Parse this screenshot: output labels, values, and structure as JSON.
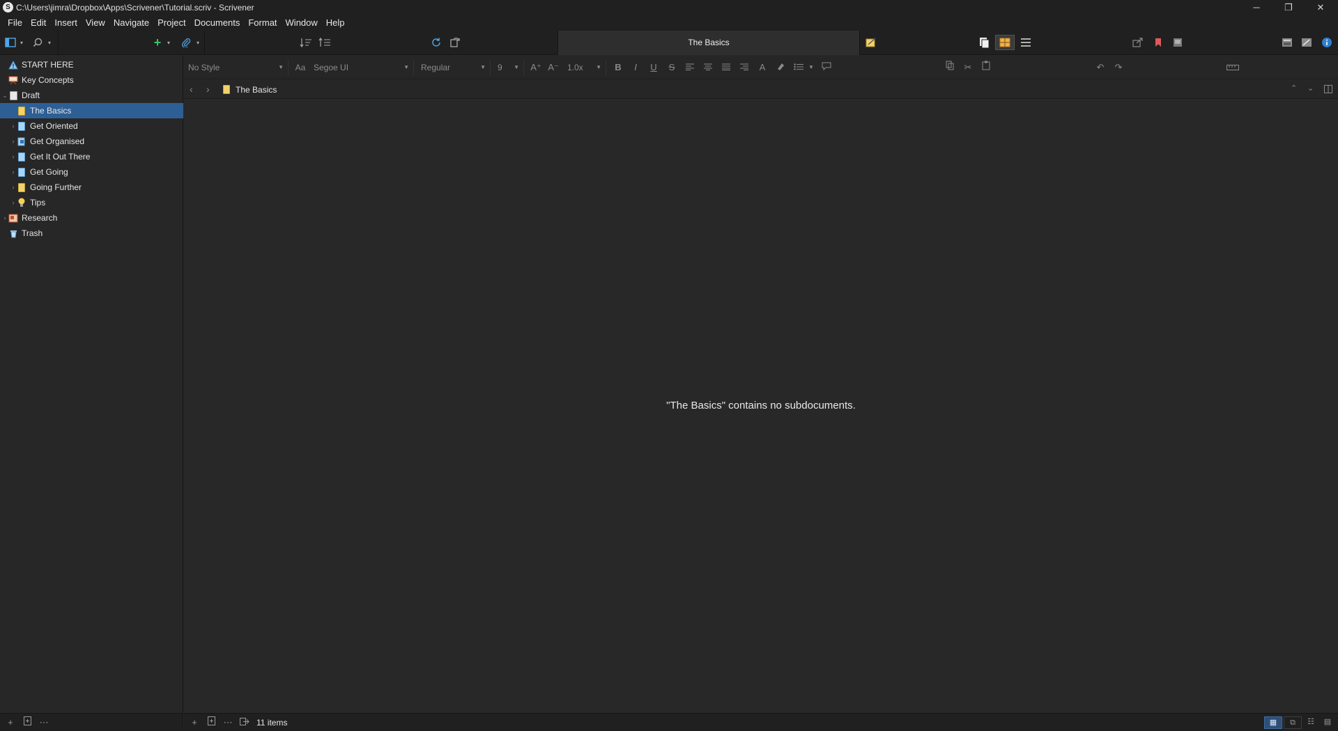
{
  "window": {
    "title": "C:\\Users\\jimra\\Dropbox\\Apps\\Scrivener\\Tutorial.scriv - Scrivener",
    "minimize": "─",
    "restore": "❐",
    "close": "✕"
  },
  "menu": [
    {
      "label": "File"
    },
    {
      "label": "Edit"
    },
    {
      "label": "Insert"
    },
    {
      "label": "View"
    },
    {
      "label": "Navigate"
    },
    {
      "label": "Project"
    },
    {
      "label": "Documents"
    },
    {
      "label": "Format"
    },
    {
      "label": "Window"
    },
    {
      "label": "Help"
    }
  ],
  "toolbar": {
    "document_title": "The Basics"
  },
  "binder": {
    "items": [
      {
        "label": "START HERE",
        "icon": "warning-icon"
      },
      {
        "label": "Key Concepts",
        "icon": "presentation-icon"
      },
      {
        "label": "Draft",
        "icon": "draft-icon"
      },
      {
        "label": "The Basics",
        "icon": "folder-note-icon",
        "selected": true
      },
      {
        "label": "Get Oriented",
        "icon": "document-icon"
      },
      {
        "label": "Get Organised",
        "icon": "document-stack-icon"
      },
      {
        "label": "Get It Out There",
        "icon": "document-icon"
      },
      {
        "label": "Get Going",
        "icon": "document-icon"
      },
      {
        "label": "Going Further",
        "icon": "folder-note-icon"
      },
      {
        "label": "Tips",
        "icon": "lightbulb-icon"
      },
      {
        "label": "Research",
        "icon": "research-icon"
      },
      {
        "label": "Trash",
        "icon": "trash-icon"
      }
    ]
  },
  "formatbar": {
    "style": "No Style",
    "font": "Segoe UI",
    "weight": "Regular",
    "size": "9",
    "line_spacing": "1.0x",
    "font_icon": "Aa",
    "bold": "B",
    "italic": "I",
    "underline": "U",
    "strike": "S",
    "color_a": "A"
  },
  "header": {
    "breadcrumb": "The Basics"
  },
  "editor": {
    "message": "\"The Basics\" contains no subdocuments."
  },
  "footer": {
    "item_count": "11 items"
  },
  "colors": {
    "background": "#282828",
    "selection": "#2d5f95",
    "accent_green": "#38c46a",
    "accent_blue": "#4fa6e8",
    "bookmark_red": "#e05a5a"
  }
}
